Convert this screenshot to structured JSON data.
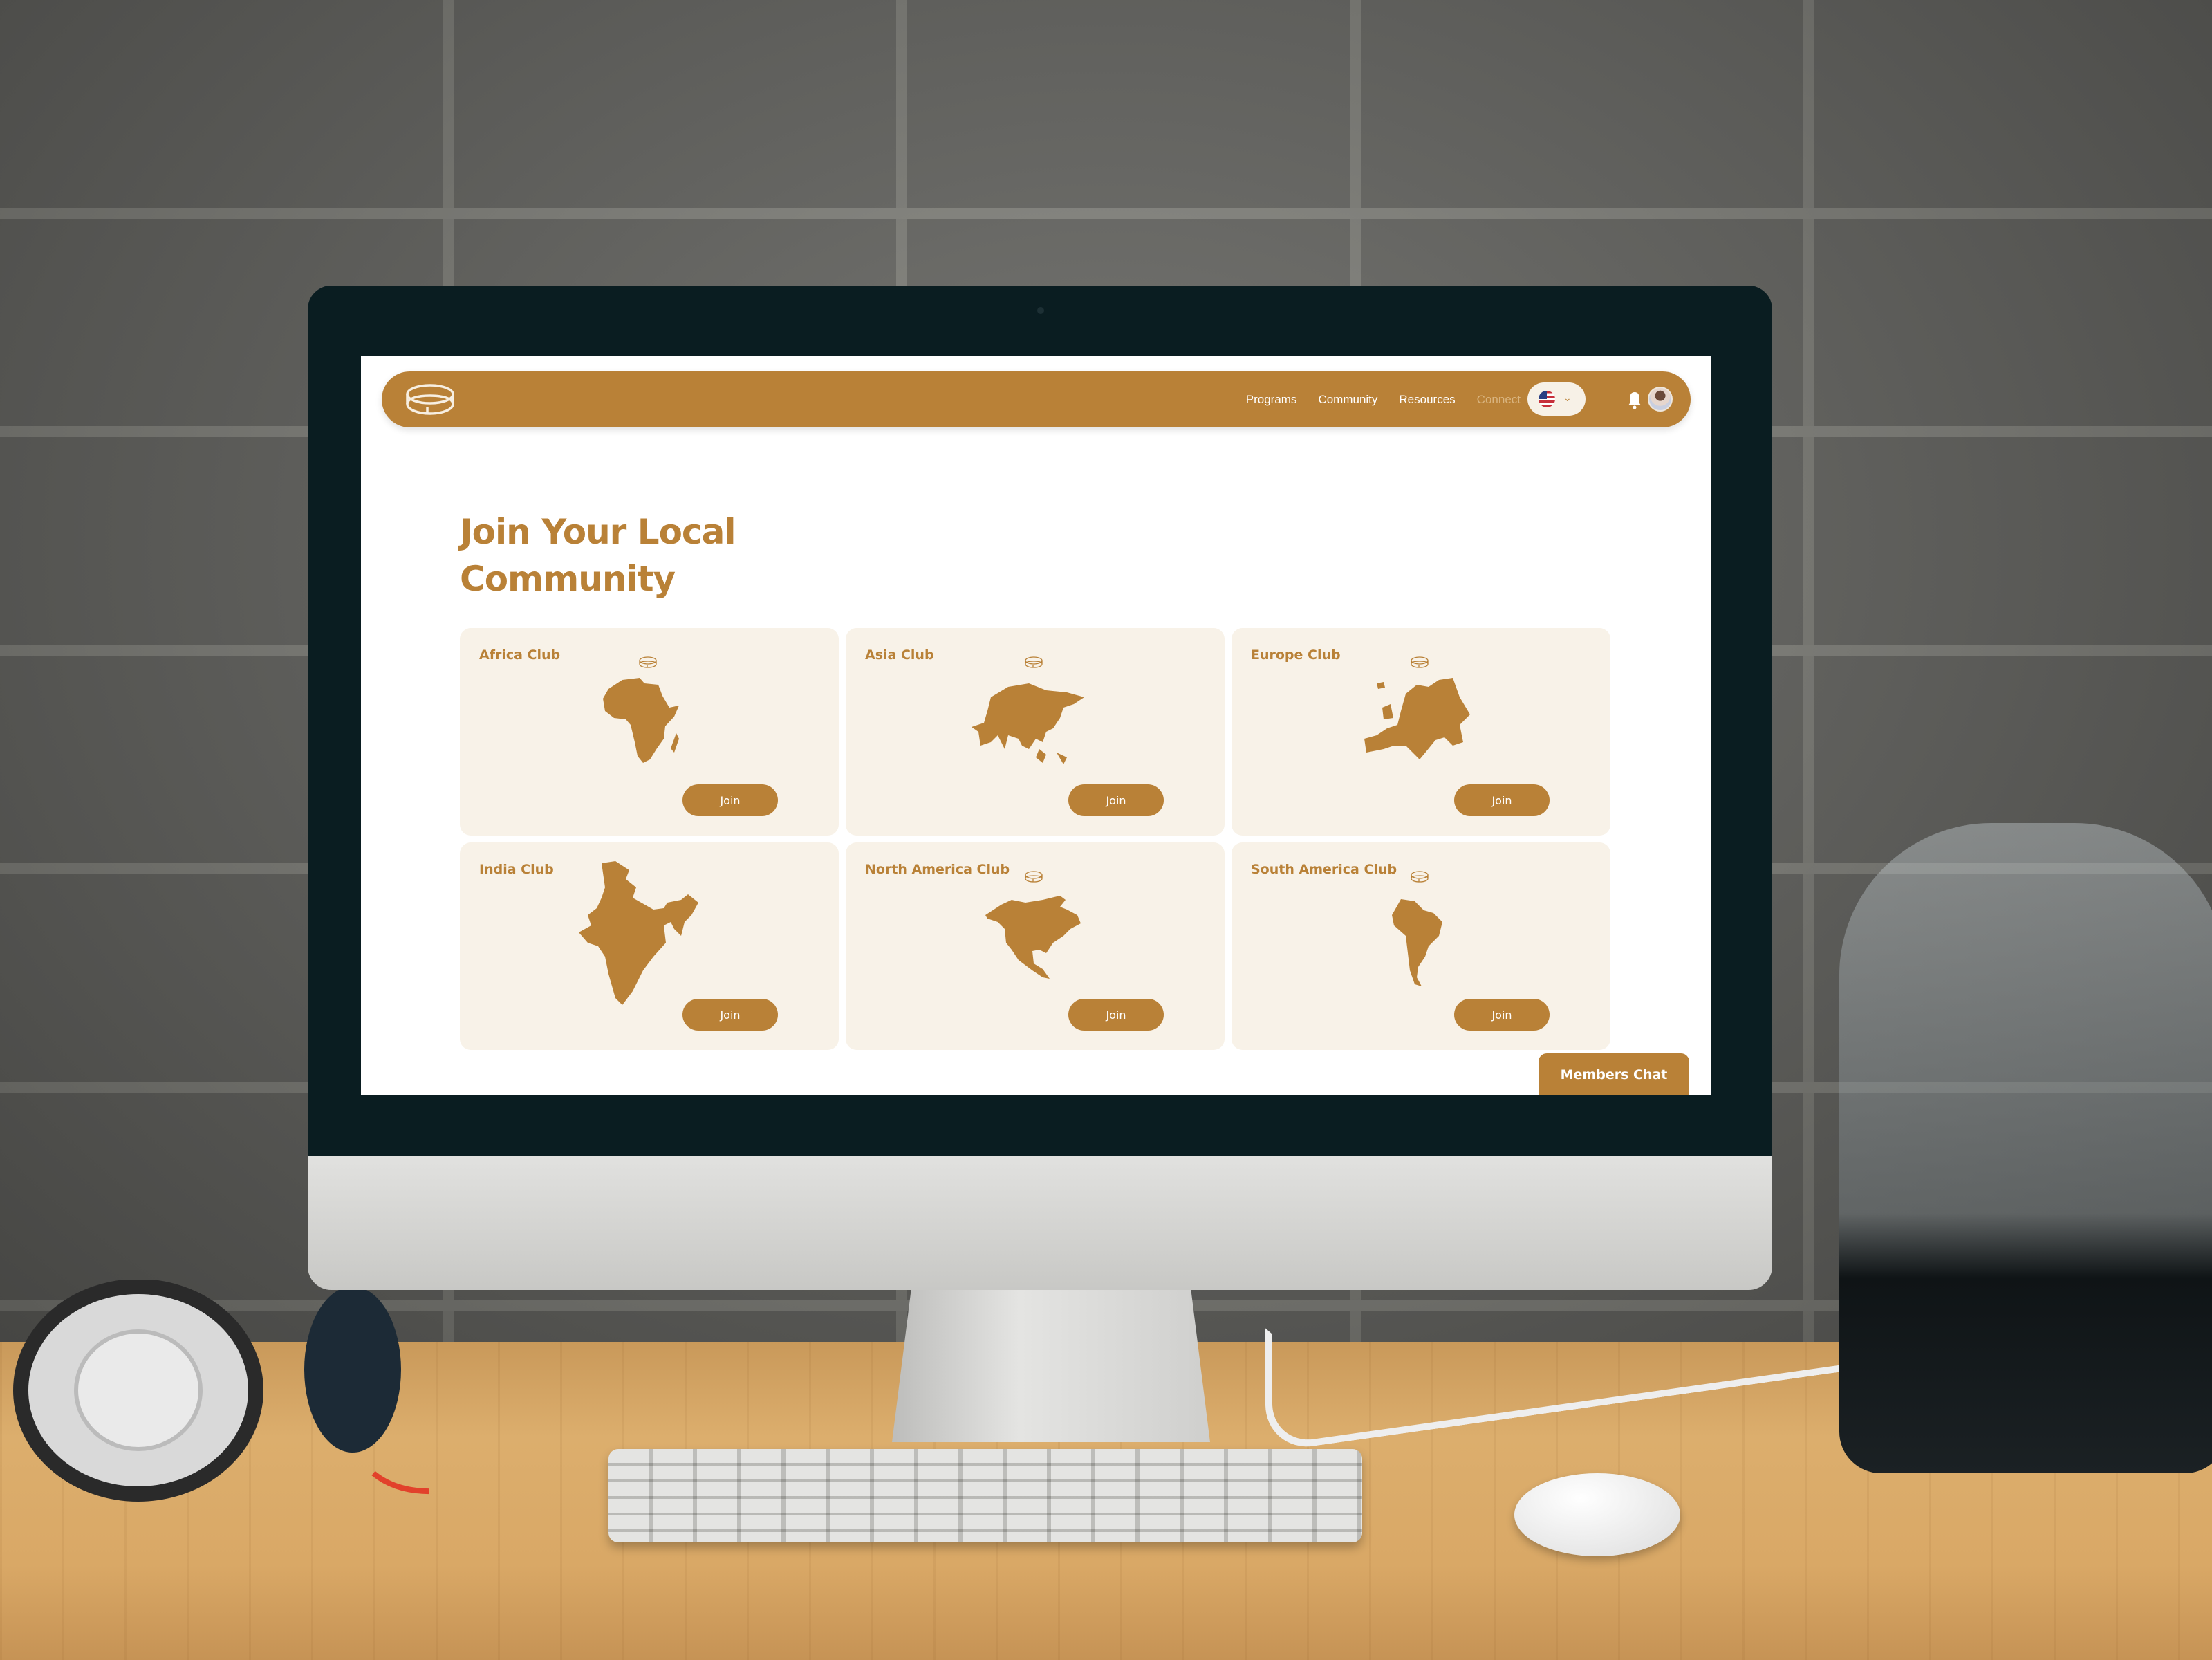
{
  "scene": {
    "description": "Desktop monitor on wooden desk in front of brick wall displaying a community website"
  },
  "brand": {
    "logo_icon": "ring-logo-icon",
    "accent_color": "#b98137",
    "card_bg": "#f8f2e8"
  },
  "nav": {
    "links": [
      {
        "label": "Programs"
      },
      {
        "label": "Community"
      },
      {
        "label": "Resources"
      },
      {
        "label": "Connect"
      }
    ],
    "language": {
      "selected": "US",
      "flag_icon": "us-flag-icon",
      "chevron_icon": "chevron-down-icon"
    },
    "notification_icon": "bell-icon",
    "avatar_icon": "user-avatar"
  },
  "page": {
    "title_line1": "Join Your Local",
    "title_line2": "Community"
  },
  "clubs": [
    {
      "name": "Africa Club",
      "map": "africa-map-icon",
      "button": "Join"
    },
    {
      "name": "Asia Club",
      "map": "asia-map-icon",
      "button": "Join"
    },
    {
      "name": "Europe Club",
      "map": "europe-map-icon",
      "button": "Join"
    },
    {
      "name": "India Club",
      "map": "india-map-icon",
      "button": "Join"
    },
    {
      "name": "North America Club",
      "map": "north-america-map-icon",
      "button": "Join"
    },
    {
      "name": "South America Club",
      "map": "south-america-map-icon",
      "button": "Join"
    }
  ],
  "members_chat": {
    "label": "Members Chat"
  }
}
